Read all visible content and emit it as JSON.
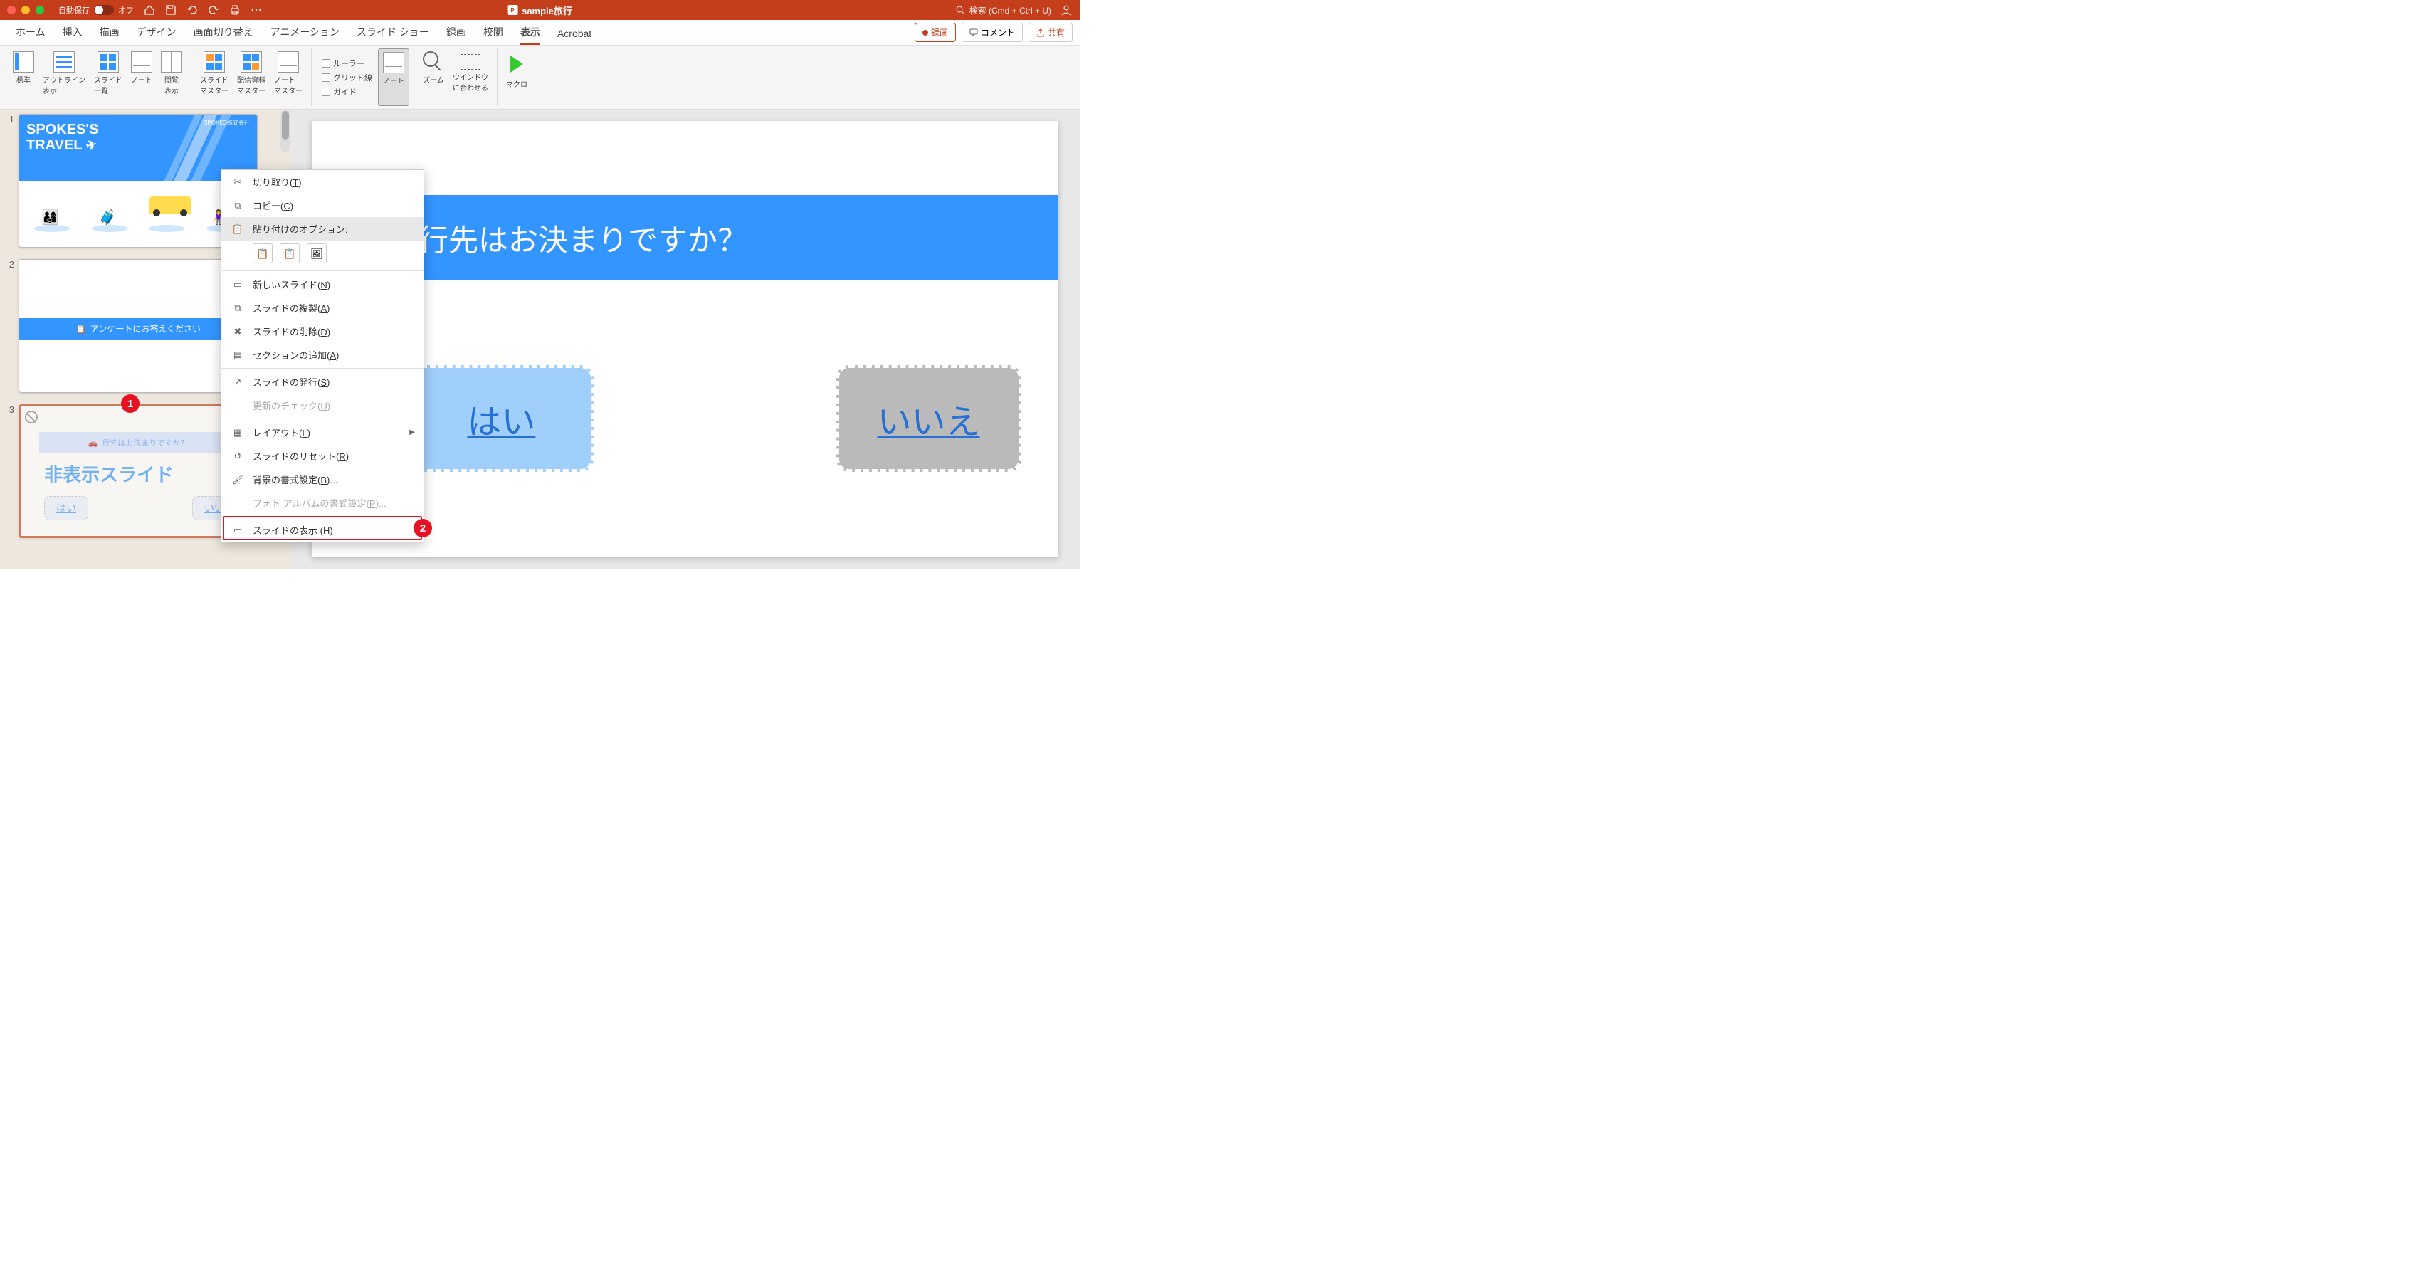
{
  "titlebar": {
    "autosave_label": "自動保存",
    "autosave_state": "オフ",
    "document_title": "sample旅行",
    "search_placeholder": "検索 (Cmd + Ctrl + U)"
  },
  "tabs": {
    "items": [
      "ホーム",
      "挿入",
      "描画",
      "デザイン",
      "画面切り替え",
      "アニメーション",
      "スライド ショー",
      "録画",
      "校閲",
      "表示",
      "Acrobat"
    ],
    "active_index": 9,
    "record": "録画",
    "comment": "コメント",
    "share": "共有"
  },
  "ribbon": {
    "views": {
      "normal": "標準",
      "outline": "アウトライン\n表示",
      "sorter": "スライド\n一覧",
      "notes": "ノート",
      "reading": "閲覧\n表示"
    },
    "masters": {
      "slide": "スライド\nマスター",
      "handout": "配信資料\nマスター",
      "notes": "ノート\nマスター"
    },
    "show": {
      "ruler": "ルーラー",
      "grid": "グリッド線",
      "guides": "ガイド",
      "notes_btn": "ノート"
    },
    "zoom": {
      "zoom": "ズーム",
      "fit": "ウインドウ\nに合わせる"
    },
    "macro": "マクロ"
  },
  "slides": {
    "slide1": {
      "title1": "SPOKES'S",
      "title2": "TRAVEL",
      "corp": "SPOKES株式会社"
    },
    "slide2": {
      "band": "アンケートにお答えください"
    },
    "slide3": {
      "band": "行先はお決まりですか？",
      "label": "非表示スライド",
      "yes": "はい",
      "no": "いいえ"
    }
  },
  "canvas": {
    "question": "行先はお決まりですか？",
    "yes": "はい",
    "no": "いいえ"
  },
  "ctx": {
    "cut": "切り取り(",
    "cut_k": "T",
    "copy": "コピー(",
    "copy_k": "C",
    "paste_label": "貼り付けのオプション:",
    "new_slide": "新しいスライド(",
    "new_slide_k": "N",
    "duplicate": "スライドの複製(",
    "duplicate_k": "A",
    "delete": "スライドの削除(",
    "delete_k": "D",
    "section": "セクションの追加(",
    "section_k": "A",
    "publish": "スライドの発行(",
    "publish_k": "S",
    "update": "更新のチェック(",
    "update_k": "U",
    "layout": "レイアウト(",
    "layout_k": "L",
    "reset": "スライドのリセット(",
    "reset_k": "R",
    "bg": "背景の書式設定(",
    "bg_k": "B",
    "photo": "フォト アルバムの書式設定(",
    "photo_k": "P",
    "show": "スライドの表示 (",
    "show_k": "H",
    "close": ")",
    "close_dots": ")..."
  },
  "badges": {
    "b1": "1",
    "b2": "2"
  }
}
